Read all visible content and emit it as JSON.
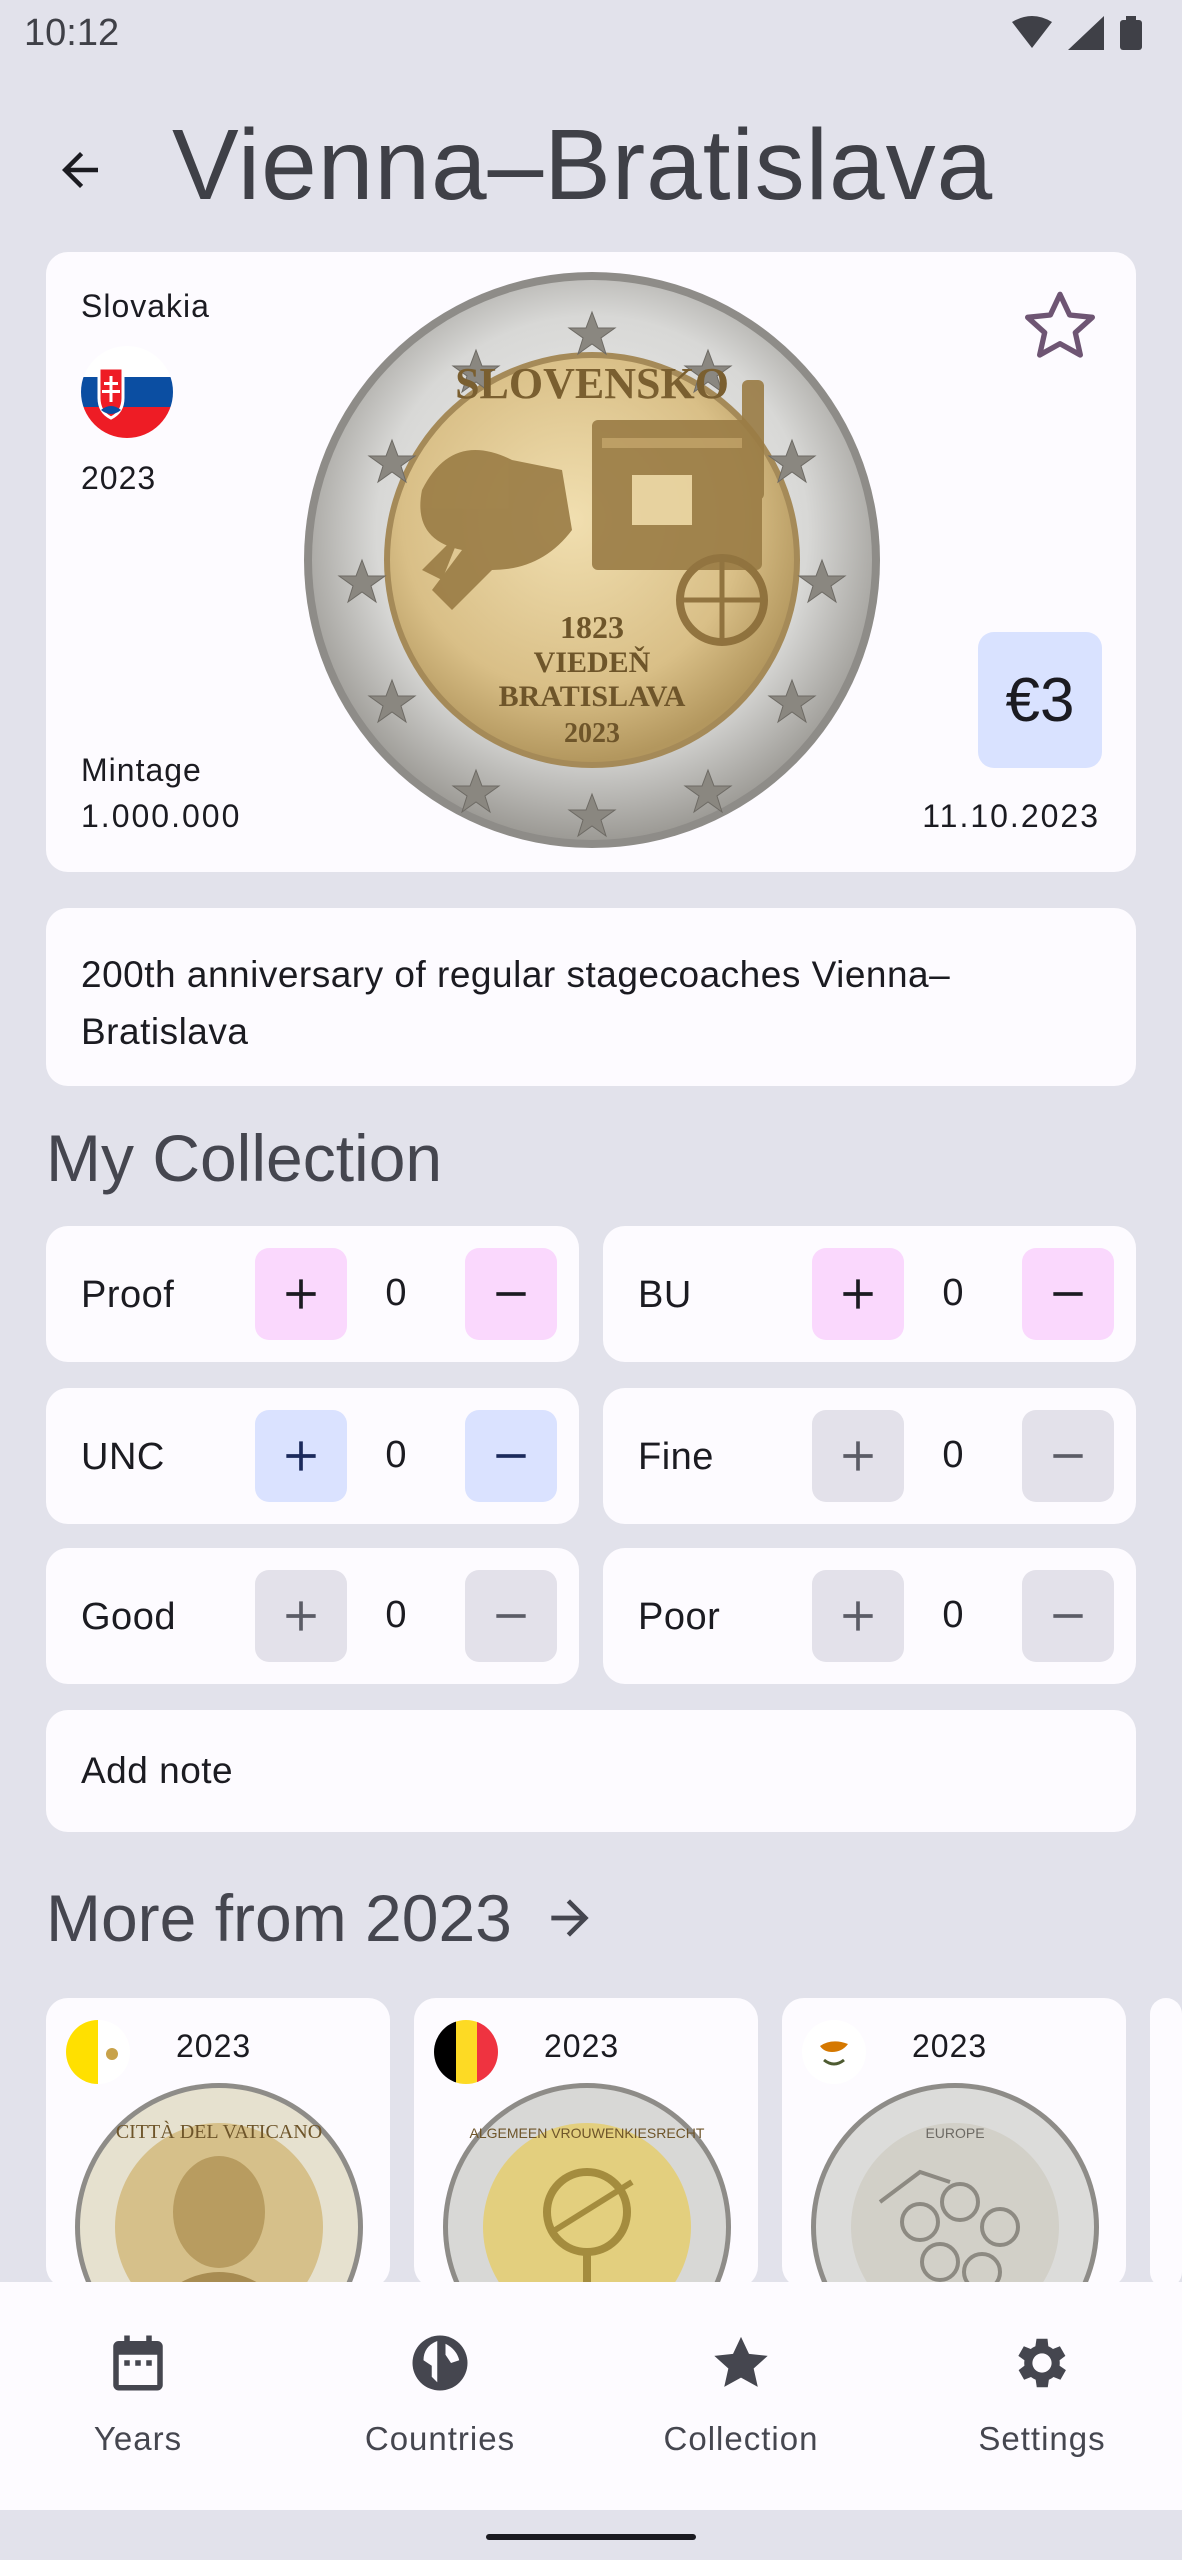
{
  "status_bar": {
    "time": "10:12",
    "icons": [
      "wifi-icon",
      "signal-icon",
      "battery-icon"
    ]
  },
  "header": {
    "title": "Vienna–Bratislava",
    "back_icon": "arrow-back-icon"
  },
  "coin": {
    "country": "Slovakia",
    "year": "2023",
    "mintage_label": "Mintage",
    "mintage": "1.000.000",
    "date": "11.10.2023",
    "value": "€3",
    "favorite_icon": "star-outline-icon",
    "coin_text": {
      "top": "SLOVENSKO",
      "line1": "1823",
      "line2": "VIEDEŇ",
      "line3": "BRATISLAVA",
      "year": "2023"
    }
  },
  "description": "200th anniversary of regular stagecoaches Vienna–Bratislava",
  "collection": {
    "title": "My Collection",
    "counters": [
      {
        "label": "Proof",
        "value": "0",
        "tone": "pink"
      },
      {
        "label": "BU",
        "value": "0",
        "tone": "pink"
      },
      {
        "label": "UNC",
        "value": "0",
        "tone": "blue"
      },
      {
        "label": "Fine",
        "value": "0",
        "tone": "grey"
      },
      {
        "label": "Good",
        "value": "0",
        "tone": "grey"
      },
      {
        "label": "Poor",
        "value": "0",
        "tone": "grey"
      }
    ],
    "note_label": "Add note"
  },
  "more": {
    "title": "More from 2023",
    "items": [
      {
        "year": "2023",
        "country_flag": "vatican-flag",
        "coin_text": "CITTÀ DEL VATICANO"
      },
      {
        "year": "2023",
        "country_flag": "belgium-flag",
        "coin_text": "ALGEMEEN VROUWENKIESRECHT"
      },
      {
        "year": "2023",
        "country_flag": "cyprus-flag",
        "coin_text": "EUROPE"
      }
    ]
  },
  "nav": {
    "items": [
      {
        "label": "Years",
        "icon": "calendar-icon"
      },
      {
        "label": "Countries",
        "icon": "globe-icon"
      },
      {
        "label": "Collection",
        "icon": "star-icon"
      },
      {
        "label": "Settings",
        "icon": "gear-icon"
      }
    ]
  },
  "colors": {
    "background": "#e2e2eb",
    "card": "#fdfbff",
    "pink_button": "#fad8fd",
    "blue_button": "#dae2ff",
    "grey_button": "#e3e1ea",
    "value_badge": "#d9e2ff"
  }
}
